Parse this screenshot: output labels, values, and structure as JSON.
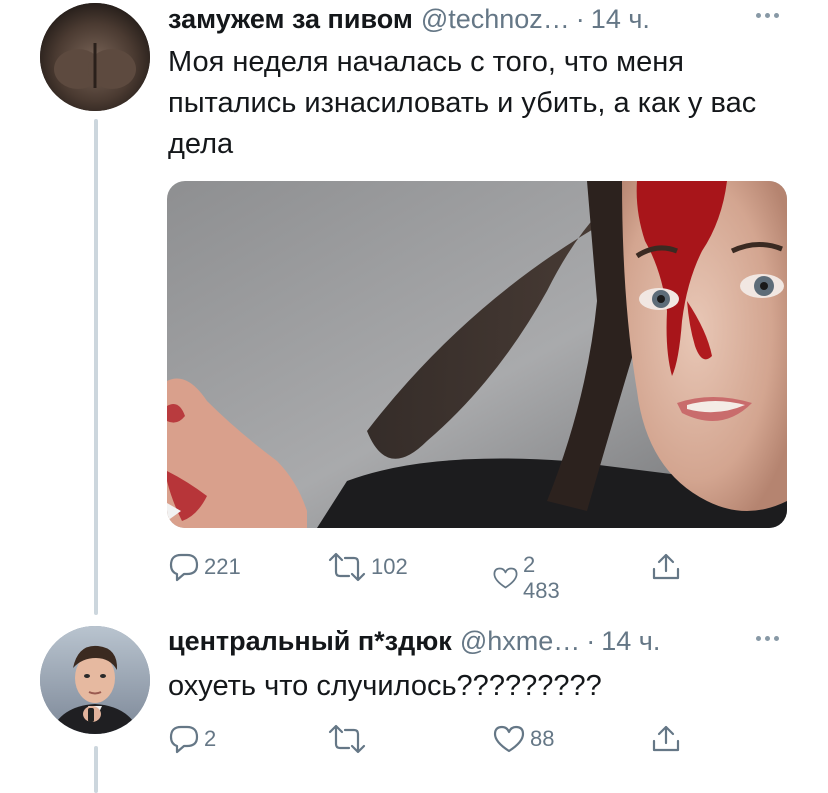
{
  "tweet_main": {
    "author": "замужем за пивом",
    "handle": "@technoz…",
    "separator": "·",
    "time": "14 ч.",
    "text": "Моя неделя началась с того, что меня пытались изнасиловать и убить, а как у вас дела",
    "media_icon": "photo-selfie",
    "actions": {
      "replies": "221",
      "retweets": "102",
      "likes": "2 483"
    }
  },
  "tweet_reply": {
    "author": "центральный п*здюк",
    "handle": "@hxme…",
    "separator": "·",
    "time": "14 ч.",
    "text": "охуеть что случилось?????????",
    "actions": {
      "replies": "2",
      "retweets": "",
      "likes": "88"
    }
  },
  "colors": {
    "text": "#14171a",
    "secondary": "#657786",
    "thread_line": "#ccd6dd"
  },
  "icons": {
    "reply": "reply-icon",
    "retweet": "retweet-icon",
    "like": "heart-icon",
    "share": "share-icon",
    "more": "more-icon"
  }
}
